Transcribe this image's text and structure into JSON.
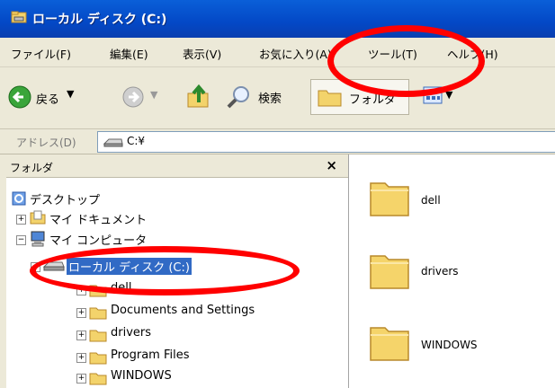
{
  "window": {
    "title": "ローカル ディスク (C:)"
  },
  "menu": [
    "ファイル(F)",
    "編集(E)",
    "表示(V)",
    "お気に入り(A)",
    "ツール(T)",
    "ヘルプ(H)"
  ],
  "toolbar": {
    "back": "戻る",
    "search": "検索",
    "folders": "フォルダ"
  },
  "address": {
    "label": "アドレス(D)",
    "path": "C:¥"
  },
  "folder_pane": {
    "title": "フォルダ",
    "close": "×",
    "tree": {
      "desktop": "デスクトップ",
      "my_documents": "マイ ドキュメント",
      "my_computer": "マイ コンピュータ",
      "local_disk": "ローカル ディスク (C:)",
      "children": [
        "dell",
        "Documents and Settings",
        "drivers",
        "Program Files",
        "WINDOWS"
      ]
    }
  },
  "files": [
    "dell",
    "drivers",
    "WINDOWS"
  ],
  "colors": {
    "title_bar": "#0348c6",
    "selection": "#316ac5",
    "highlight_ellipse": "#ff0000",
    "folder": "#f5d46a"
  }
}
